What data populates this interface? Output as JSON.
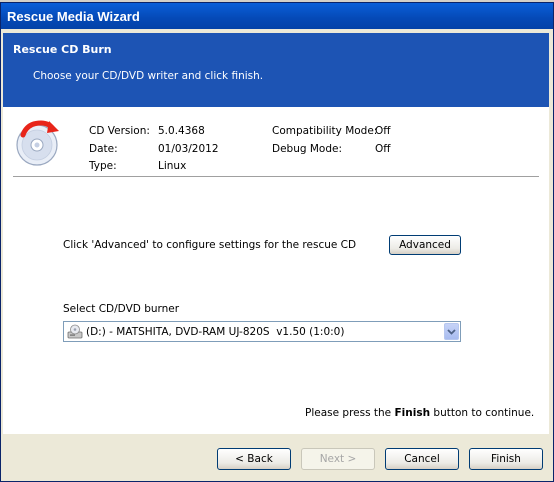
{
  "window": {
    "title": "Rescue Media Wizard"
  },
  "header": {
    "title": "Rescue CD Burn",
    "subtitle": "Choose your CD/DVD writer and click finish."
  },
  "info": {
    "cd_version_label": "CD Version:",
    "cd_version_value": "5.0.4368",
    "date_label": "Date:",
    "date_value": "01/03/2012",
    "type_label": "Type:",
    "type_value": "Linux",
    "compat_label": "Compatibility Mode:",
    "compat_value": "Off",
    "debug_label": "Debug Mode:",
    "debug_value": "Off"
  },
  "advanced": {
    "text": "Click 'Advanced' to configure settings for the rescue CD",
    "button_label": "Advanced"
  },
  "burner": {
    "label": "Select CD/DVD burner",
    "selected": "(D:) - MATSHITA, DVD-RAM UJ-820S  v1.50 (1:0:0)"
  },
  "finish_note": {
    "prefix": "Please press the ",
    "bold": "Finish",
    "suffix": " button to continue."
  },
  "buttons": {
    "back": "< Back",
    "next": "Next >",
    "cancel": "Cancel",
    "finish": "Finish"
  },
  "colors": {
    "header_bg": "#1d54b4",
    "titlebar": "#0549b6",
    "icon_arrow": "#e8251a"
  },
  "icons": {
    "cd": "cd-burn-icon",
    "drive": "cd-drive-icon",
    "dropdown": "chevron-down-icon"
  }
}
